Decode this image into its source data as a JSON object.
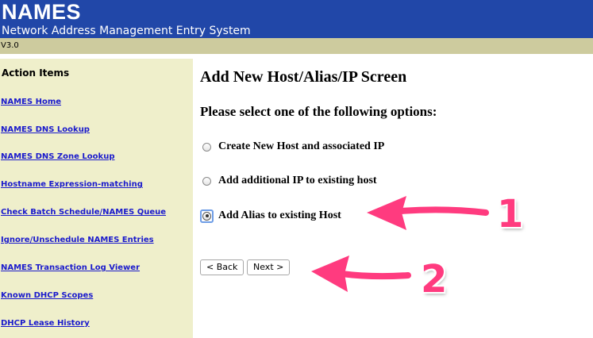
{
  "header": {
    "title": "NAMES",
    "subtitle": "Network Address Management Entry System",
    "version": "V3.0"
  },
  "sidebar": {
    "title": "Action Items",
    "items": [
      {
        "label": "NAMES Home"
      },
      {
        "label": "NAMES DNS Lookup"
      },
      {
        "label": "NAMES DNS Zone Lookup"
      },
      {
        "label": "Hostname Expression-matching"
      },
      {
        "label": "Check Batch Schedule/NAMES Queue"
      },
      {
        "label": "Ignore/Unschedule NAMES Entries"
      },
      {
        "label": "NAMES Transaction Log Viewer"
      },
      {
        "label": "Known DHCP Scopes"
      },
      {
        "label": "DHCP Lease History"
      }
    ]
  },
  "main": {
    "title": "Add New Host/Alias/IP Screen",
    "prompt": "Please select one of the following options:",
    "options": [
      {
        "label": "Create New Host and associated IP",
        "selected": false
      },
      {
        "label": "Add additional IP to existing host",
        "selected": false
      },
      {
        "label": "Add Alias to existing Host",
        "selected": true
      }
    ],
    "back_label": "< Back",
    "next_label": "Next >"
  },
  "annotations": {
    "arrow_color": "#ff3b7f",
    "numbers": [
      "1",
      "2"
    ]
  },
  "colors": {
    "header_bg": "#2147a8",
    "version_bar_bg": "#cdcb9e",
    "sidebar_bg": "#efefcb",
    "link": "#1a1acc"
  }
}
